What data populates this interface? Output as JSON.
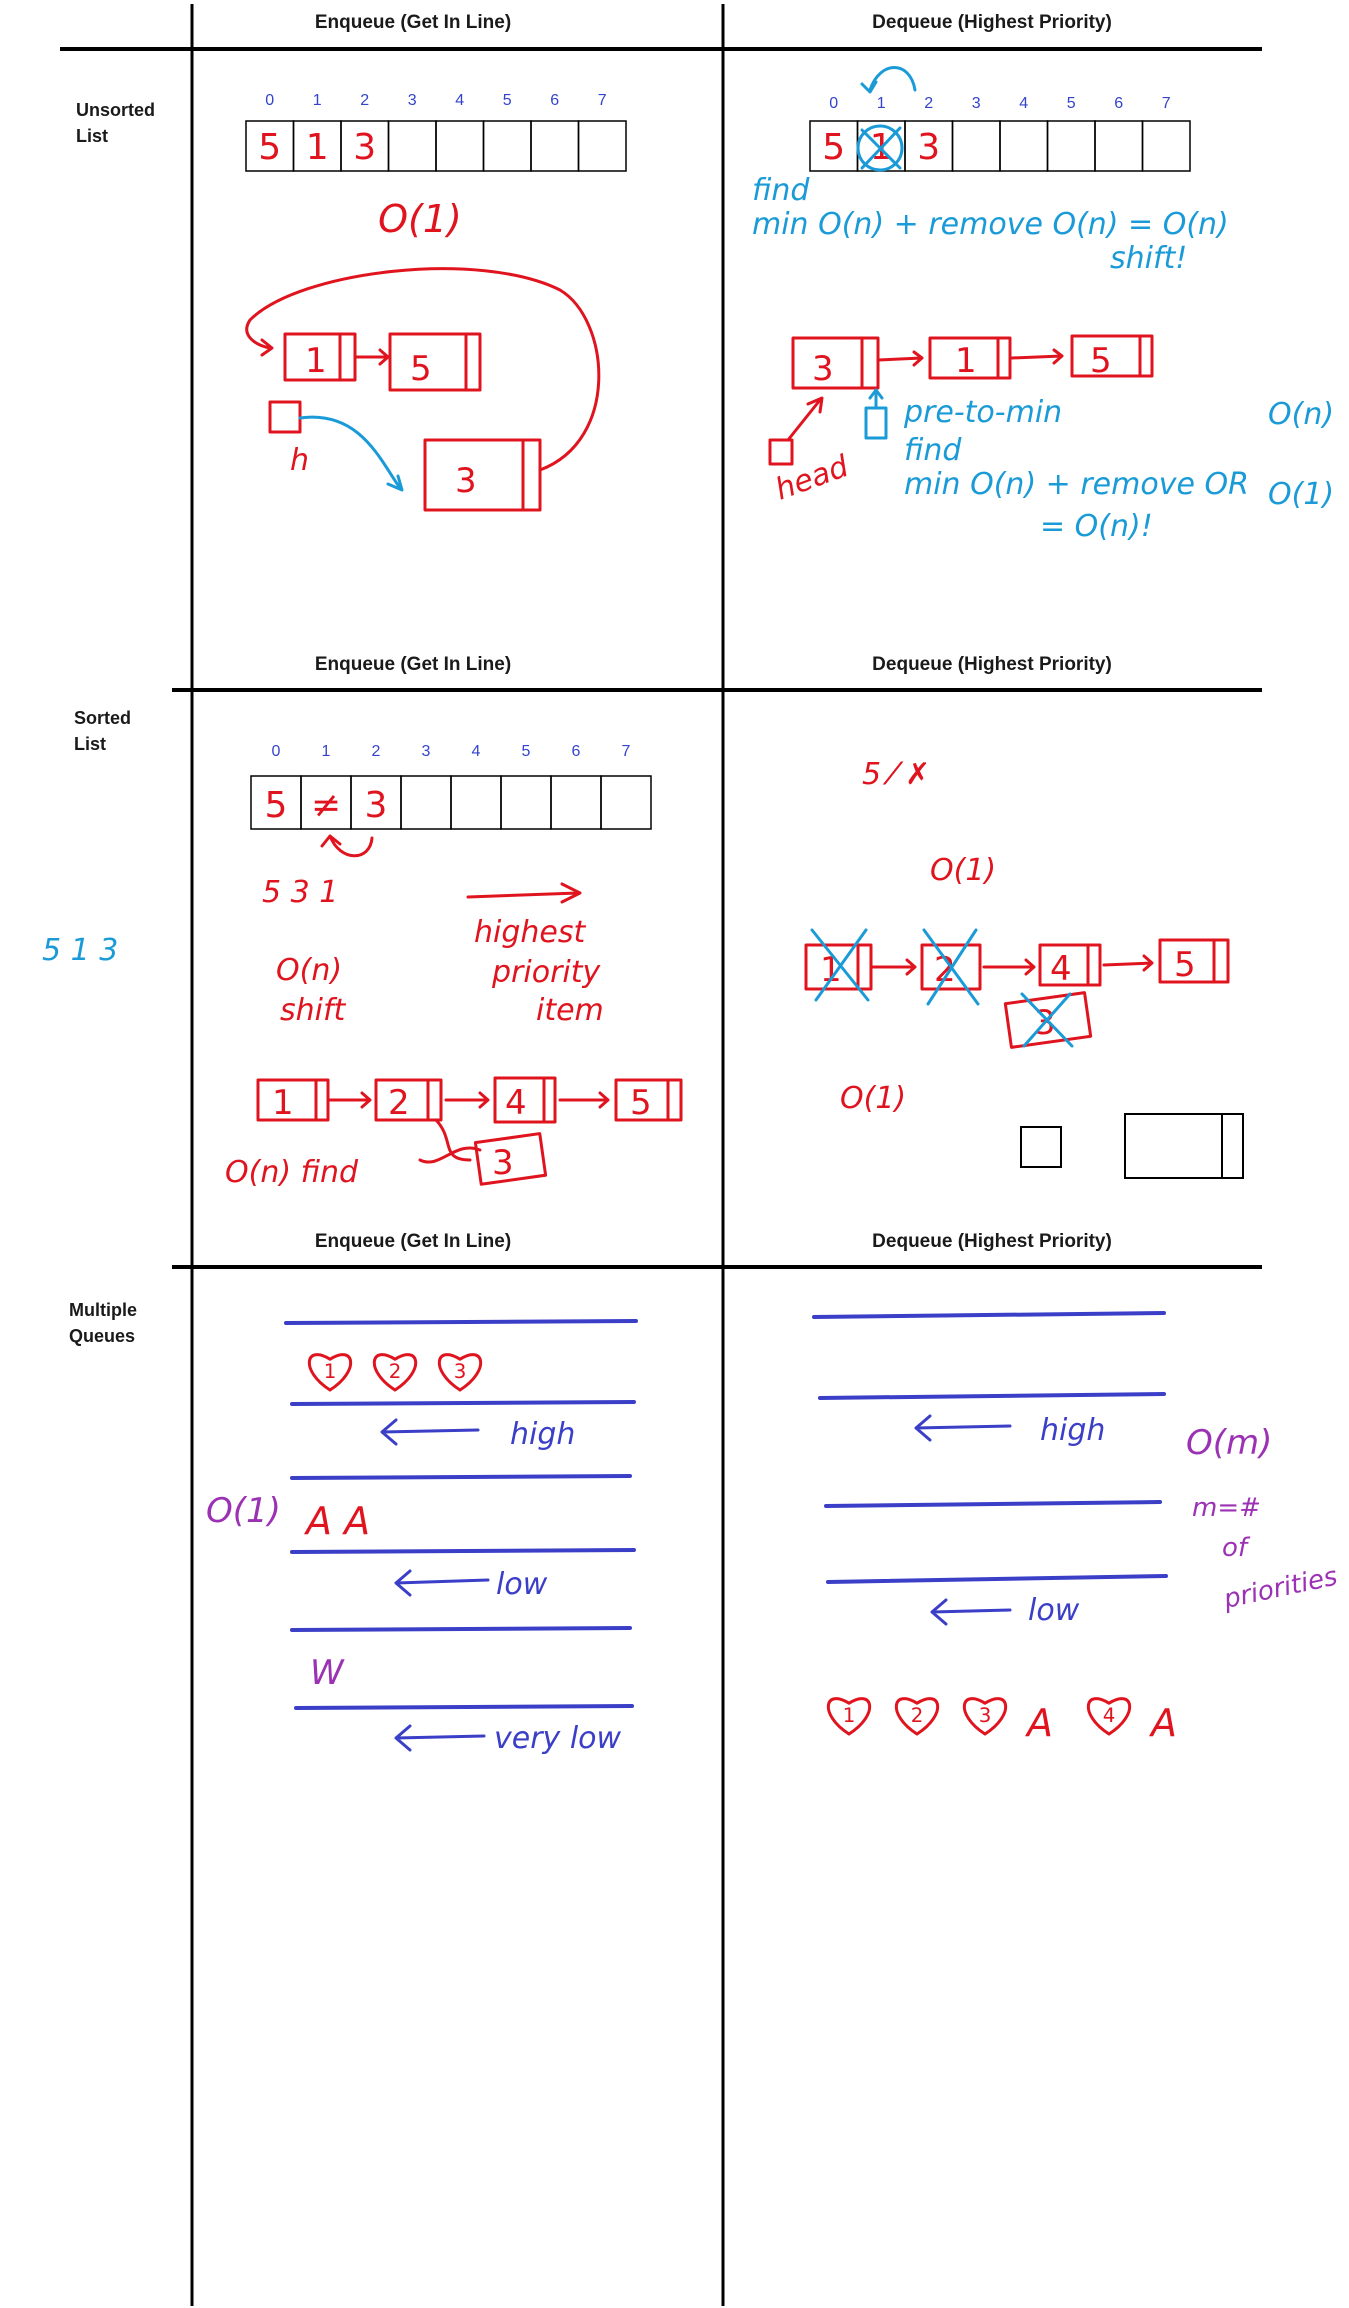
{
  "columns": {
    "enqueue_header": "Enqueue (Get In Line)",
    "dequeue_header": "Dequeue (Highest Priority)"
  },
  "rows": {
    "unsorted_label": [
      "Unsorted",
      "List"
    ],
    "sorted_label": [
      "Sorted",
      "List"
    ],
    "multiple_label": [
      "Multiple",
      "Queues"
    ]
  },
  "array": {
    "indices": [
      "0",
      "1",
      "2",
      "3",
      "4",
      "5",
      "6",
      "7"
    ],
    "unsorted_cells": [
      "5",
      "1",
      "3",
      "",
      "",
      "",
      "",
      ""
    ],
    "sorted_cells": [
      "5",
      "≠",
      "3",
      "",
      "",
      "",
      "",
      ""
    ]
  },
  "unsorted_enqueue": {
    "cost": "O(1)",
    "nodes": [
      "1",
      "5",
      "3"
    ],
    "pointer": "h"
  },
  "unsorted_dequeue": {
    "note_line1": "find",
    "note_line2": "min O(n) + remove O(n) = O(n)",
    "note_shift": "shift!",
    "nodes": [
      "3",
      "1",
      "5"
    ],
    "head_label": "head",
    "pre_to_min": "pre-to-min",
    "find_min_line1": "find",
    "find_min_line2": "min O(n) + remove OR",
    "find_min_result": "= O(n)!",
    "remove_options": [
      "O(n)",
      "O(1)"
    ]
  },
  "side_note": "5 1 3",
  "sorted_enqueue": {
    "order": "5 3 1",
    "cost": "O(n)",
    "cost_note": "shift",
    "arrow_caption": [
      "highest",
      "priority",
      "item"
    ],
    "nodes": [
      "1",
      "2",
      "4",
      "5"
    ],
    "inserted_node": "3",
    "find_cost": "O(n) find"
  },
  "sorted_dequeue": {
    "crossed": "5 ⁄ ✗",
    "cost_top": "O(1)",
    "nodes": [
      "1",
      "2",
      "4",
      "5"
    ],
    "inserted_node": "3",
    "cost_bottom": "O(1)"
  },
  "multi_enqueue": {
    "cost": "O(1)",
    "hearts": [
      "1",
      "2",
      "3"
    ],
    "mid_items": "A A",
    "low_items": "W",
    "queue_labels": [
      "high",
      "low",
      "very low"
    ]
  },
  "multi_dequeue": {
    "cost": "O(m)",
    "m_note": [
      "m=#",
      "of",
      "priorities"
    ],
    "queue_labels": [
      "high",
      "low"
    ],
    "result_hearts": [
      "1",
      "2",
      "3"
    ],
    "result_heart4": "4",
    "result_letter": "A"
  }
}
